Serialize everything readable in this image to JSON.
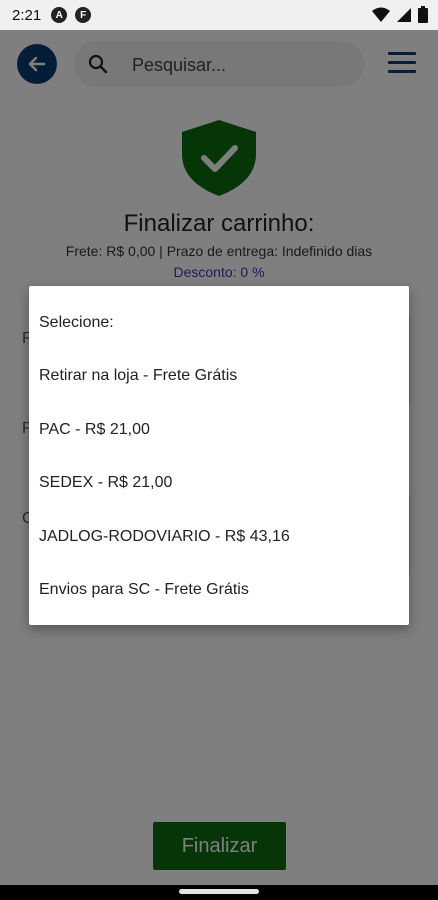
{
  "status_bar": {
    "time": "2:21",
    "badge_1": "A",
    "badge_2": "F"
  },
  "search": {
    "placeholder": "Pesquisar..."
  },
  "checkout": {
    "title": "Finalizar carrinho:",
    "frete_line": "Frete: R$ 0,00 | Prazo de entrega: Indefinido dias",
    "desconto_line": "Desconto: 0 %",
    "hidden_letters": [
      "R",
      "R",
      "C"
    ],
    "finalize_label": "Finalizar"
  },
  "dialog": {
    "title": "Selecione:",
    "options": [
      "Retirar na loja - Frete Grátis",
      "PAC - R$ 21,00",
      "SEDEX - R$ 21,00",
      "JADLOG-RODOVIARIO - R$ 43,16",
      "Envios para SC - Frete Grátis"
    ]
  },
  "colors": {
    "primary": "#0d3b73",
    "success": "#0d6b11",
    "discount_text": "#2b3dbb"
  }
}
